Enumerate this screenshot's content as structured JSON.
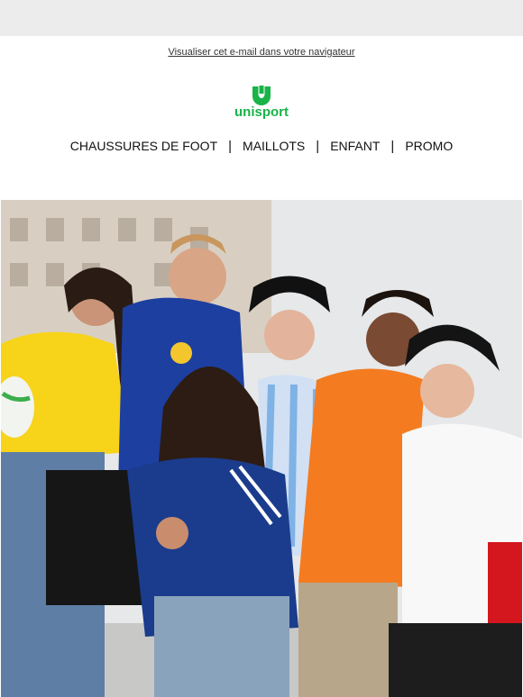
{
  "header": {
    "view_in_browser": "Visualiser cet e-mail dans votre navigateur",
    "logo_text": "unisport",
    "brand_color": "#19b34a"
  },
  "nav": {
    "items": [
      {
        "label": "CHAUSSURES DE FOOT"
      },
      {
        "label": "MAILLOTS"
      },
      {
        "label": "ENFANT"
      },
      {
        "label": "PROMO"
      }
    ],
    "separator": "|"
  },
  "hero": {
    "image": "group-of-fans-wearing-national-team-jerseys",
    "jersey_colors": [
      "#f7d31a",
      "#1d3fa0",
      "#1b3c8c",
      "#ffffff",
      "#f47b20",
      "#f8f8f8"
    ]
  }
}
